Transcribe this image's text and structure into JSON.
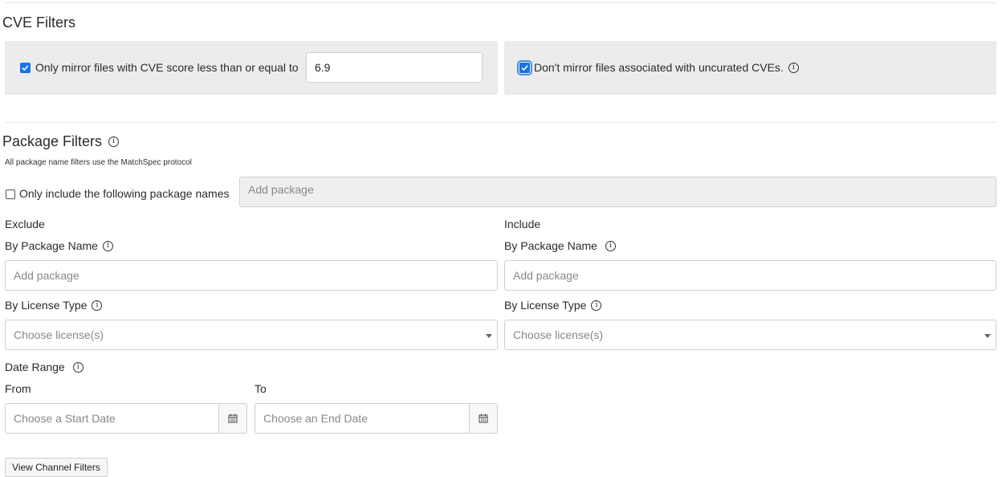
{
  "cve": {
    "title": "CVE Filters",
    "score_filter": {
      "checked": true,
      "label": "Only mirror files with CVE score less than or equal to",
      "value": "6.9"
    },
    "uncurated": {
      "checked": true,
      "label": "Don't mirror files associated with uncurated CVEs."
    }
  },
  "package": {
    "title": "Package Filters",
    "subtitle": "All package name filters use the MatchSpec protocol",
    "only_include": {
      "checked": false,
      "label": "Only include the following package names",
      "placeholder": "Add package"
    }
  },
  "exclude": {
    "heading": "Exclude",
    "by_name_label": "By Package Name",
    "name_placeholder": "Add package",
    "by_license_label": "By License Type",
    "license_placeholder": "Choose license(s)"
  },
  "include": {
    "heading": "Include",
    "by_name_label": "By Package Name",
    "name_placeholder": "Add package",
    "by_license_label": "By License Type",
    "license_placeholder": "Choose license(s)"
  },
  "date_range": {
    "label": "Date Range",
    "from_label": "From",
    "to_label": "To",
    "start_placeholder": "Choose a Start Date",
    "end_placeholder": "Choose an End Date"
  },
  "view_channel_filters_label": "View Channel Filters",
  "icons": {
    "info": "info-circle-icon",
    "calendar": "calendar-icon",
    "caret": "caret-down-icon",
    "check": "checkmark-icon"
  },
  "colors": {
    "accent": "#1a73e8",
    "panel_bg": "#ececec"
  }
}
